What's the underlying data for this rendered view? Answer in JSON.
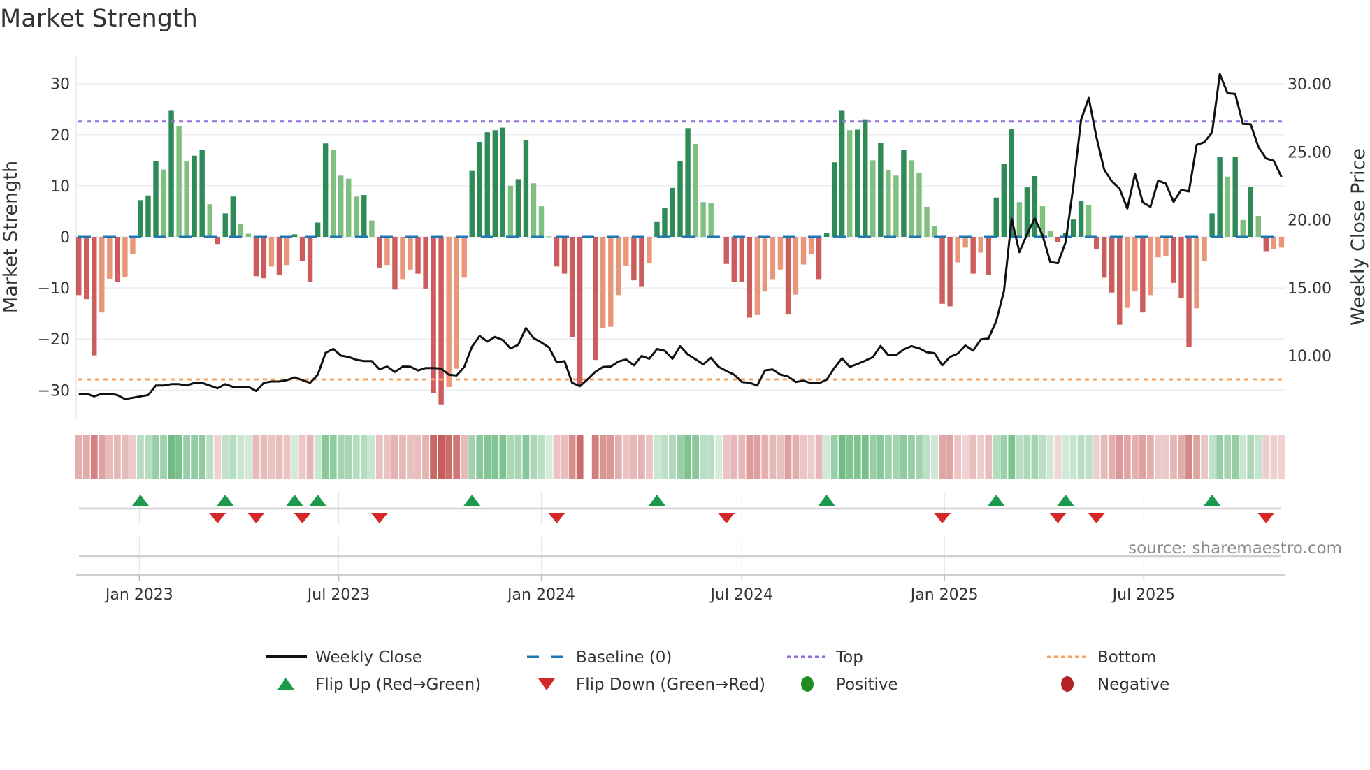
{
  "title": "Market Strength",
  "source": "source: sharemaestro.com",
  "colors": {
    "strong_green": "#2e8b57",
    "weak_green": "#7fbf7f",
    "strong_red": "#cd5c5c",
    "weak_red": "#e9967a",
    "baseline": "#1f77b4",
    "top": "#9370db",
    "bottom": "#f4a460",
    "flip_up": "#1a9a4a",
    "flip_down": "#d62728",
    "positive": "#228b22",
    "negative": "#b22222",
    "price": "#111111"
  },
  "legend": [
    {
      "label": "Weekly Close",
      "icon": "solid-line"
    },
    {
      "label": "Baseline (0)",
      "icon": "dashed-line"
    },
    {
      "label": "Top",
      "icon": "dotted-line"
    },
    {
      "label": "Bottom",
      "icon": "dotted-line"
    },
    {
      "label": "Flip Up (Red→Green)",
      "icon": "triangle-up"
    },
    {
      "label": "Flip Down (Green→Red)",
      "icon": "triangle-down"
    },
    {
      "label": "Positive",
      "icon": "circle"
    },
    {
      "label": "Negative",
      "icon": "circle"
    }
  ],
  "chart_data": {
    "type": "bar+line",
    "title": "Market Strength",
    "ylabel": "Market Strength",
    "y2label": "Weekly Close Price",
    "ylim": [
      -35,
      35
    ],
    "y2lim": [
      5.5,
      31.5
    ],
    "y_ticks": [
      {
        "v": 30,
        "label": "30"
      },
      {
        "v": 20,
        "label": "20"
      },
      {
        "v": 10,
        "label": "10"
      },
      {
        "v": 0,
        "label": "0"
      },
      {
        "v": -10,
        "label": "−10"
      },
      {
        "v": -20,
        "label": "−20"
      },
      {
        "v": -30,
        "label": "−30"
      }
    ],
    "y2_ticks": [
      {
        "v": 30,
        "label": "30.00"
      },
      {
        "v": 25,
        "label": "25.00"
      },
      {
        "v": 20,
        "label": "20.00"
      },
      {
        "v": 15,
        "label": "15.00"
      },
      {
        "v": 10,
        "label": "10.00"
      }
    ],
    "x_ticks": [
      {
        "date": "2023-01-01",
        "label": "Jan 2023"
      },
      {
        "date": "2023-07-01",
        "label": "Jul 2023"
      },
      {
        "date": "2024-01-01",
        "label": "Jan 2024"
      },
      {
        "date": "2024-07-01",
        "label": "Jul 2024"
      },
      {
        "date": "2025-01-01",
        "label": "Jan 2025"
      },
      {
        "date": "2025-07-01",
        "label": "Jul 2025"
      }
    ],
    "grid": true,
    "legend_position": "bottom",
    "start_date": "2022-11-07",
    "frequency": "weekly",
    "top_level": 22.6,
    "bottom_level": -27.9,
    "baseline": 0,
    "strength": [
      -11.4,
      -12.2,
      -23.2,
      -14.8,
      -8.2,
      -8.8,
      -7.9,
      -3.4,
      7.2,
      8.1,
      14.9,
      13.2,
      24.7,
      21.7,
      14.8,
      15.9,
      17.0,
      6.4,
      -1.4,
      4.6,
      7.9,
      2.6,
      0.6,
      -7.7,
      -8.1,
      -5.8,
      -7.4,
      -5.5,
      0.5,
      -4.7,
      -8.8,
      2.8,
      18.3,
      17.1,
      12.0,
      11.4,
      7.9,
      8.2,
      3.2,
      -6.0,
      -5.5,
      -10.3,
      -8.4,
      -6.4,
      -7.2,
      -10.1,
      -30.6,
      -32.8,
      -29.4,
      -25.8,
      -8.0,
      12.9,
      18.6,
      20.5,
      20.9,
      21.4,
      10.0,
      11.3,
      19.0,
      10.5,
      6.0,
      0.1,
      -5.8,
      -7.2,
      -19.6,
      -29.2,
      null,
      -24.1,
      -17.8,
      -17.6,
      -11.4,
      -5.7,
      -8.5,
      -9.8,
      -5.1,
      2.9,
      5.7,
      9.6,
      14.8,
      21.3,
      18.2,
      6.8,
      6.6,
      0,
      -5.3,
      -8.8,
      -8.8,
      -15.8,
      -15.3,
      -10.7,
      -8.4,
      -6.4,
      -15.2,
      -11.3,
      -5.4,
      -3.3,
      -8.4,
      0.8,
      14.6,
      24.7,
      20.9,
      21.0,
      22.9,
      15.0,
      18.4,
      13.1,
      12.0,
      17.1,
      15.0,
      12.6,
      5.9,
      2.1,
      -13.1,
      -13.6,
      -5.0,
      -2.1,
      -7.2,
      -3.1,
      -7.5,
      7.7,
      14.3,
      21.1,
      6.8,
      9.7,
      11.9,
      6.0,
      1.2,
      -1.1,
      0.8,
      3.4,
      7.0,
      6.3,
      -2.4,
      -8.0,
      -10.9,
      -17.2,
      -13.9,
      -10.7,
      -14.8,
      -11.4,
      -4.0,
      -3.7,
      -9.0,
      -11.9,
      -21.5,
      -14.0,
      -4.7,
      4.6,
      15.6,
      11.8,
      15.6,
      3.3,
      9.8,
      4.1,
      -2.8,
      -2.4,
      -2.1
    ],
    "weekly_close": [
      7.2,
      7.2,
      7.0,
      7.2,
      7.2,
      7.1,
      6.8,
      6.9,
      7.0,
      7.1,
      7.8,
      7.8,
      7.9,
      7.9,
      7.8,
      8.0,
      8.0,
      7.8,
      7.6,
      7.9,
      7.7,
      7.7,
      7.7,
      7.4,
      8.0,
      8.1,
      8.1,
      8.2,
      8.4,
      8.2,
      8.0,
      8.6,
      10.2,
      10.5,
      10.0,
      9.9,
      9.7,
      9.6,
      9.6,
      9.0,
      9.2,
      8.8,
      9.2,
      9.19,
      8.91,
      9.09,
      9.09,
      9.05,
      8.6,
      8.54,
      9.17,
      10.66,
      11.45,
      11.04,
      11.38,
      11.14,
      10.53,
      10.8,
      12.03,
      11.28,
      10.97,
      10.6,
      9.5,
      9.6,
      8.0,
      7.75,
      8.26,
      8.81,
      9.17,
      9.2,
      9.57,
      9.72,
      9.29,
      9.98,
      9.77,
      10.49,
      10.36,
      9.77,
      10.7,
      10.08,
      9.74,
      9.36,
      9.84,
      9.17,
      8.88,
      8.6,
      8.06,
      8.01,
      7.8,
      8.92,
      8.98,
      8.61,
      8.47,
      8.06,
      8.16,
      7.97,
      7.97,
      8.23,
      9.09,
      9.81,
      9.17,
      9.39,
      9.63,
      9.89,
      10.71,
      10.03,
      10.03,
      10.46,
      10.7,
      10.54,
      10.25,
      10.18,
      9.29,
      9.91,
      10.15,
      10.75,
      10.37,
      11.19,
      11.26,
      12.55,
      14.74,
      20.06,
      17.62,
      18.94,
      20.09,
      18.86,
      16.9,
      16.8,
      18.34,
      22.46,
      27.34,
      28.97,
      26.06,
      23.69,
      22.83,
      22.28,
      20.83,
      23.38,
      21.29,
      20.95,
      22.88,
      22.66,
      21.31,
      22.2,
      22.08,
      25.51,
      25.71,
      26.43,
      30.72,
      29.31,
      29.26,
      27.05,
      27.03,
      25.37,
      24.51,
      24.34,
      23.14
    ],
    "flip_up_dates": [
      "2023-01-02",
      "2023-03-20",
      "2023-05-22",
      "2023-06-12",
      "2023-10-30",
      "2024-04-15",
      "2024-09-16",
      "2025-02-17",
      "2025-04-21",
      "2025-09-01"
    ],
    "flip_down_dates": [
      "2023-03-13",
      "2023-04-17",
      "2023-05-29",
      "2023-08-07",
      "2024-01-15",
      "2024-06-17",
      "2024-12-30",
      "2025-04-14",
      "2025-05-19",
      "2025-10-20"
    ]
  }
}
